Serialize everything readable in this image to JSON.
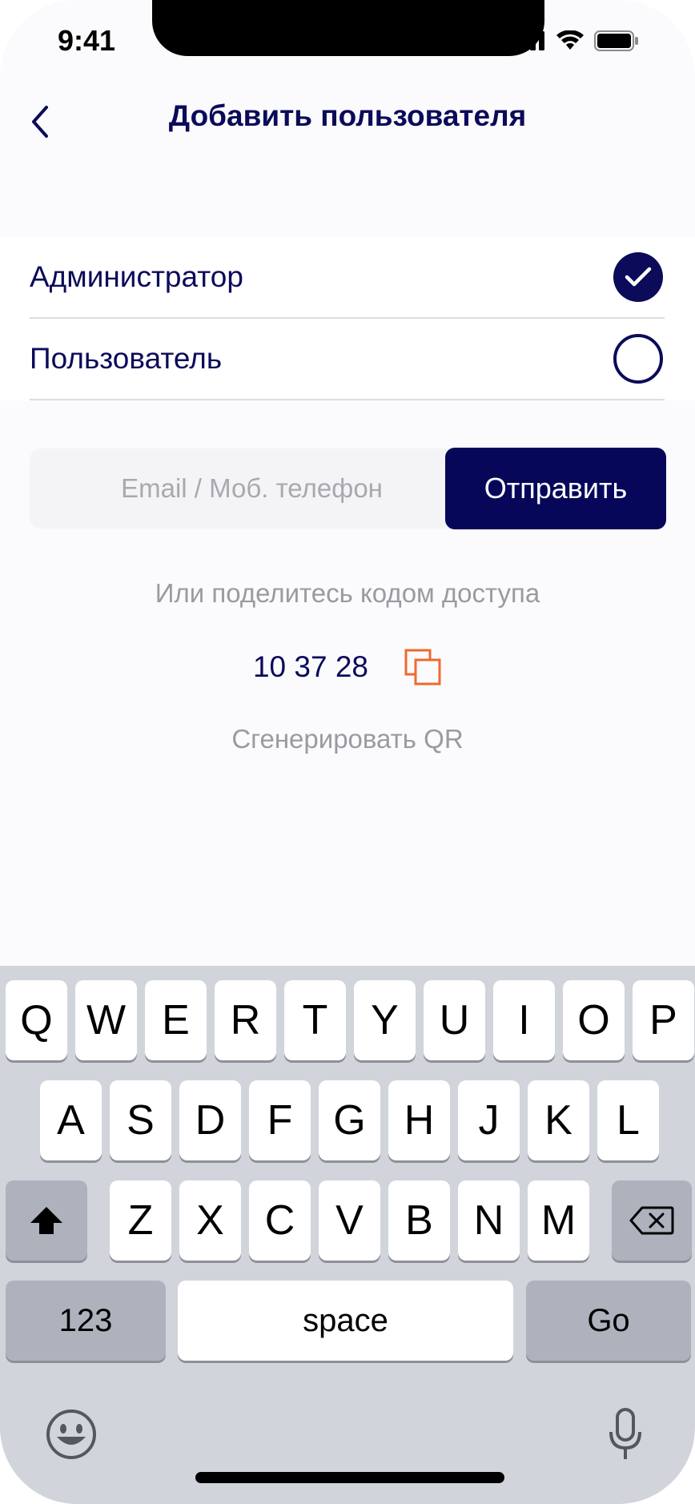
{
  "status_bar": {
    "time": "9:41"
  },
  "header": {
    "title": "Добавить пользователя"
  },
  "roles": [
    {
      "label": "Администратор",
      "selected": true
    },
    {
      "label": "Пользователь",
      "selected": false
    }
  ],
  "invite": {
    "placeholder": "Email / Моб. телефон",
    "value": "",
    "send_label": "Отправить"
  },
  "share": {
    "text": "Или поделитесь кодом доступа",
    "code": "10 37 28",
    "qr_label": "Сгенерировать QR"
  },
  "keyboard": {
    "row1": [
      "Q",
      "W",
      "E",
      "R",
      "T",
      "Y",
      "U",
      "I",
      "O",
      "P"
    ],
    "row2": [
      "A",
      "S",
      "D",
      "F",
      "G",
      "H",
      "J",
      "K",
      "L"
    ],
    "row3": [
      "Z",
      "X",
      "C",
      "V",
      "B",
      "N",
      "M"
    ],
    "numbers_label": "123",
    "space_label": "space",
    "go_label": "Go"
  },
  "colors": {
    "brand": "#07075a",
    "accent": "#ef6a2e",
    "muted": "#9a9aa2"
  }
}
